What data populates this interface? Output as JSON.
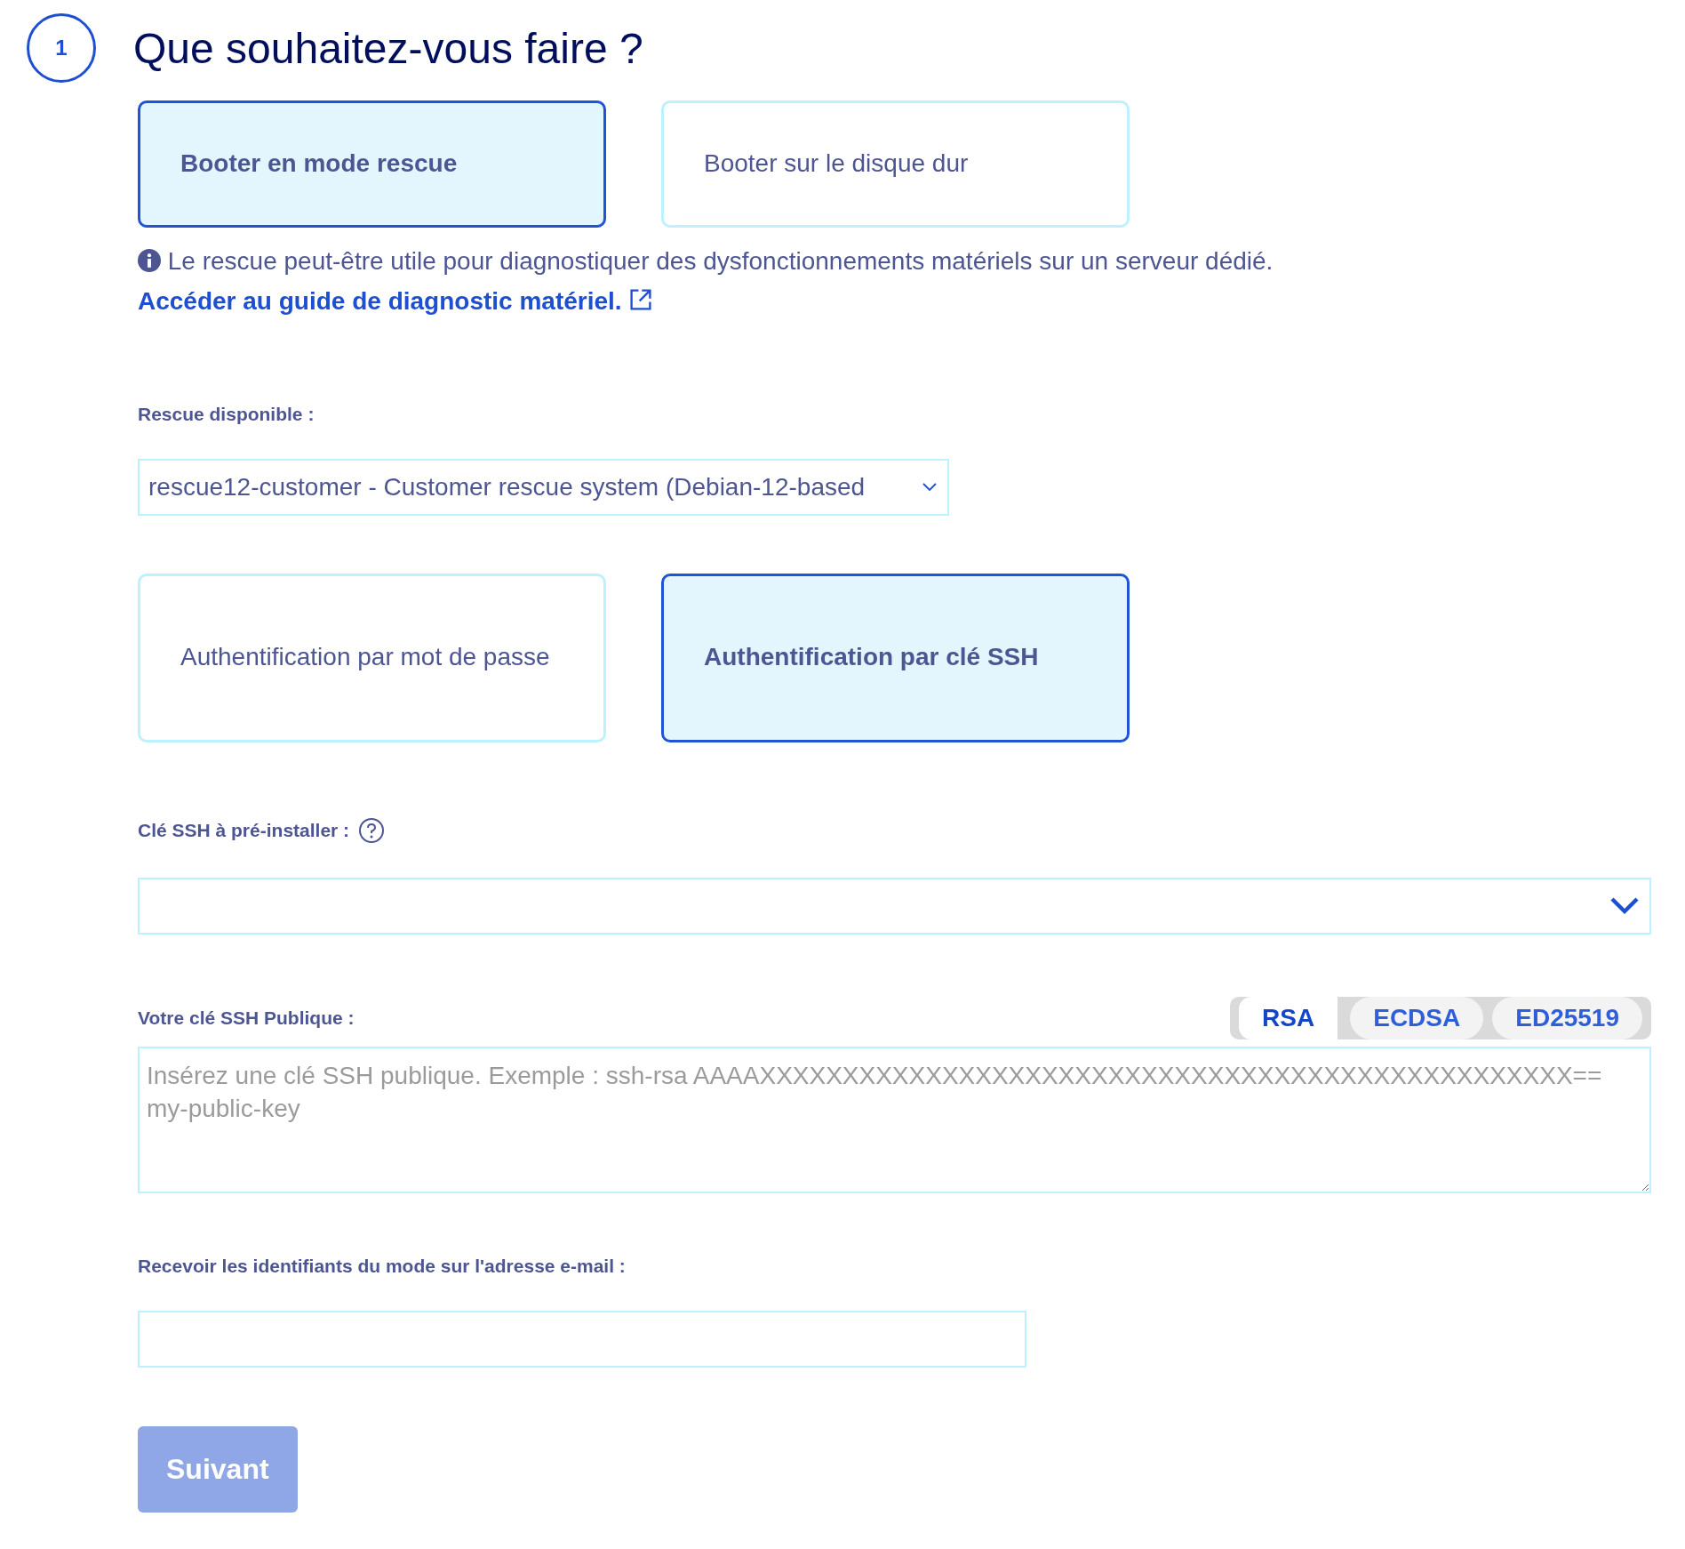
{
  "step": {
    "number": "1",
    "title": "Que souhaitez-vous faire ?"
  },
  "boot_options": [
    {
      "label": "Booter en mode rescue",
      "selected": true
    },
    {
      "label": "Booter sur le disque dur",
      "selected": false
    }
  ],
  "info": {
    "text": "Le rescue peut-être utile pour diagnostiquer des dysfonctionnements matériels sur un serveur dédié.",
    "link": "Accéder au guide de diagnostic matériel."
  },
  "rescue_select": {
    "label": "Rescue disponible :",
    "value": "rescue12-customer - Customer rescue system (Debian-12-based"
  },
  "auth_options": [
    {
      "label": "Authentification par mot de passe",
      "selected": false
    },
    {
      "label": "Authentification par clé SSH",
      "selected": true
    }
  ],
  "ssh_key_select": {
    "label": "Clé SSH à pré-installer :"
  },
  "public_key": {
    "label": "Votre clé SSH Publique :",
    "key_types": [
      {
        "label": "RSA",
        "selected": true
      },
      {
        "label": "ECDSA",
        "selected": false
      },
      {
        "label": "ED25519",
        "selected": false
      }
    ],
    "placeholder": "Insérez une clé SSH publique. Exemple : ssh-rsa AAAAXXXXXXXXXXXXXXXXXXXXXXXXXXXXXXXXXXXXXXXXXXXXXXXXX== my-public-key"
  },
  "email": {
    "label": "Recevoir les identifiants du mode sur l'adresse e-mail :"
  },
  "next_button": {
    "label": "Suivant",
    "disabled": true
  }
}
